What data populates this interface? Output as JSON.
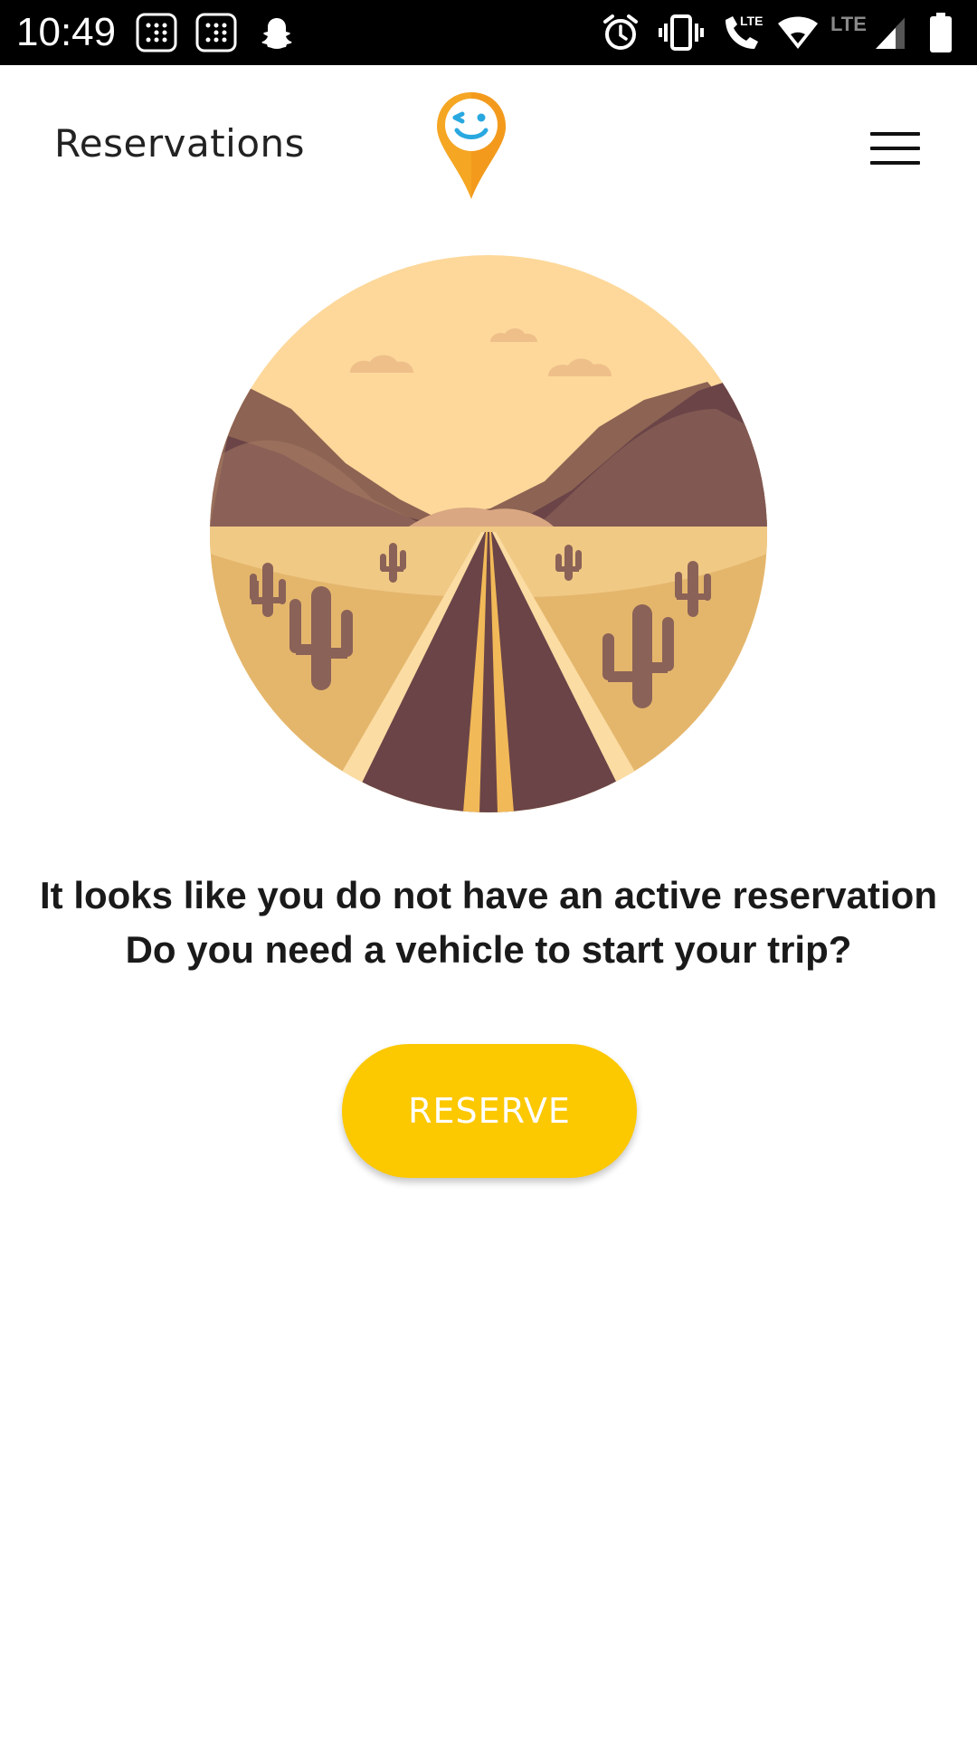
{
  "status_bar": {
    "time": "10:49",
    "icons": [
      "grid-app-icon",
      "grid-app-icon",
      "snapchat-icon",
      "alarm-icon",
      "vibrate-icon",
      "lte-call-icon",
      "wifi-icon",
      "lte-signal-icon",
      "battery-icon"
    ],
    "network_label": "LTE",
    "call_label": "LTE"
  },
  "header": {
    "title": "Reservations",
    "logo_icon": "map-pin-wink-logo",
    "menu_icon": "hamburger-menu-icon"
  },
  "main": {
    "illustration": "desert-road-illustration",
    "message_line_1": "It looks like you do not have an active reservation",
    "message_line_2": "Do you need a vehicle to start your trip?",
    "reserve_label": "RESERVE"
  },
  "colors": {
    "accent": "#fcc800",
    "logo_orange": "#f5a623",
    "logo_face": "#29a8e0",
    "status_bar": "#000000"
  }
}
